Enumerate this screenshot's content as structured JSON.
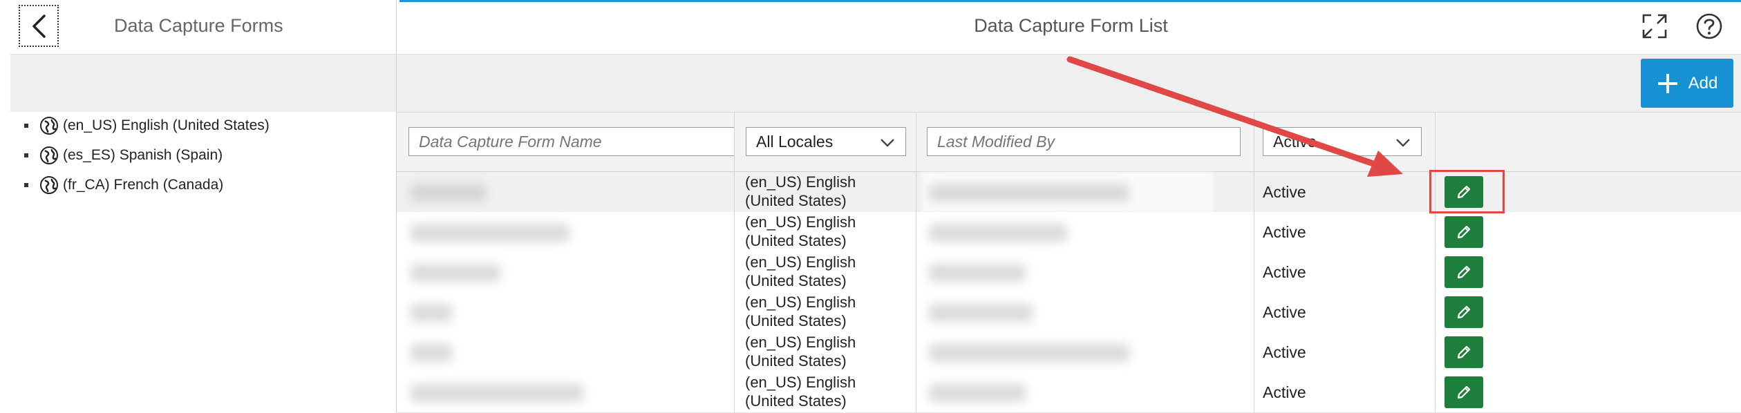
{
  "left": {
    "title": "Data Capture Forms",
    "tree": [
      {
        "label": "(en_US) English (United States)"
      },
      {
        "label": "(es_ES) Spanish (Spain)"
      },
      {
        "label": "(fr_CA) French (Canada)"
      }
    ]
  },
  "main": {
    "title": "Data Capture Form List",
    "add_label": "Add"
  },
  "filters": {
    "name_placeholder": "Data Capture Form Name",
    "locale_value": "All Locales",
    "modified_placeholder": "Last Modified By",
    "status_value": "Active"
  },
  "rows": [
    {
      "locale_line1": "(en_US) English",
      "locale_line2": "(United States)",
      "status": "Active"
    },
    {
      "locale_line1": "(en_US) English",
      "locale_line2": "(United States)",
      "status": "Active"
    },
    {
      "locale_line1": "(en_US) English",
      "locale_line2": "(United States)",
      "status": "Active"
    },
    {
      "locale_line1": "(en_US) English",
      "locale_line2": "(United States)",
      "status": "Active"
    },
    {
      "locale_line1": "(en_US) English",
      "locale_line2": "(United States)",
      "status": "Active"
    },
    {
      "locale_line1": "(en_US) English",
      "locale_line2": "(United States)",
      "status": "Active"
    }
  ],
  "colors": {
    "accent": "#1591d4",
    "edit_button": "#1e7f3c",
    "annotation": "#e04848"
  },
  "icons": [
    "chevron-left-icon",
    "globe-icon",
    "fullscreen-icon",
    "help-icon",
    "plus-icon",
    "chevron-down-icon",
    "pencil-icon"
  ]
}
